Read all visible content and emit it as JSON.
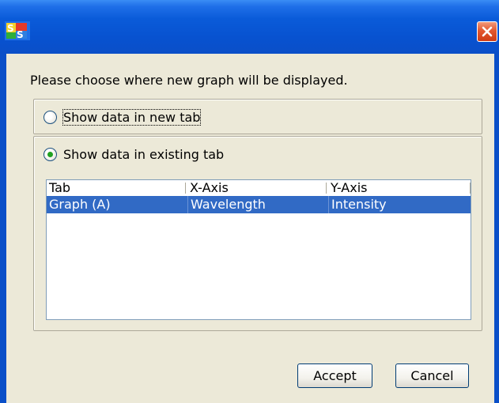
{
  "dialog": {
    "prompt": "Please choose where new graph will be displayed.",
    "option_new_tab": "Show data in new tab",
    "option_existing_tab": "Show data in existing tab",
    "selected_option": "existing_tab"
  },
  "table": {
    "columns": [
      "Tab",
      "X-Axis",
      "Y-Axis"
    ],
    "rows": [
      [
        "Graph (A)",
        "Wavelength",
        "Intensity"
      ]
    ]
  },
  "buttons": {
    "accept": "Accept",
    "cancel": "Cancel"
  },
  "icons": {
    "app": "app-logo-icon",
    "close": "close-icon"
  },
  "colors": {
    "titlebar": "#0a5bd9",
    "close": "#e3572f",
    "selection": "#316ac5",
    "radio_dot": "#21a121"
  }
}
